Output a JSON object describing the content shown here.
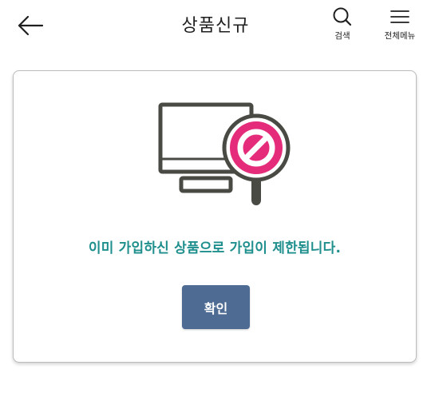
{
  "header": {
    "title": "상품신규",
    "back_icon": "arrow-left-icon",
    "search_label": "검색",
    "search_icon": "search-icon",
    "menu_label": "전체메뉴",
    "menu_icon": "hamburger-menu-icon"
  },
  "dialog": {
    "illustration_icon": "monitor-prohibited-icon",
    "message": "이미 가입하신 상품으로 가입이 제한됩니다.",
    "confirm_label": "확인"
  },
  "colors": {
    "message": "#1f8f8d",
    "button": "#4d6b93",
    "prohibit": "#e52c7a",
    "icon_stroke": "#4a4a45"
  }
}
